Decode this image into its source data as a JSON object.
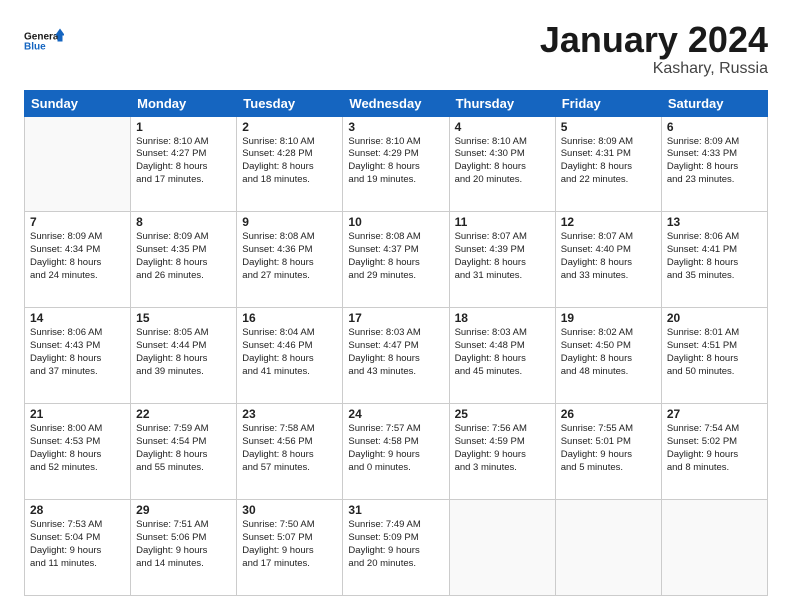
{
  "logo": {
    "line1": "General",
    "line2": "Blue"
  },
  "title": "January 2024",
  "subtitle": "Kashary, Russia",
  "weekdays": [
    "Sunday",
    "Monday",
    "Tuesday",
    "Wednesday",
    "Thursday",
    "Friday",
    "Saturday"
  ],
  "weeks": [
    [
      {
        "day": "",
        "info": ""
      },
      {
        "day": "1",
        "info": "Sunrise: 8:10 AM\nSunset: 4:27 PM\nDaylight: 8 hours\nand 17 minutes."
      },
      {
        "day": "2",
        "info": "Sunrise: 8:10 AM\nSunset: 4:28 PM\nDaylight: 8 hours\nand 18 minutes."
      },
      {
        "day": "3",
        "info": "Sunrise: 8:10 AM\nSunset: 4:29 PM\nDaylight: 8 hours\nand 19 minutes."
      },
      {
        "day": "4",
        "info": "Sunrise: 8:10 AM\nSunset: 4:30 PM\nDaylight: 8 hours\nand 20 minutes."
      },
      {
        "day": "5",
        "info": "Sunrise: 8:09 AM\nSunset: 4:31 PM\nDaylight: 8 hours\nand 22 minutes."
      },
      {
        "day": "6",
        "info": "Sunrise: 8:09 AM\nSunset: 4:33 PM\nDaylight: 8 hours\nand 23 minutes."
      }
    ],
    [
      {
        "day": "7",
        "info": "Sunrise: 8:09 AM\nSunset: 4:34 PM\nDaylight: 8 hours\nand 24 minutes."
      },
      {
        "day": "8",
        "info": "Sunrise: 8:09 AM\nSunset: 4:35 PM\nDaylight: 8 hours\nand 26 minutes."
      },
      {
        "day": "9",
        "info": "Sunrise: 8:08 AM\nSunset: 4:36 PM\nDaylight: 8 hours\nand 27 minutes."
      },
      {
        "day": "10",
        "info": "Sunrise: 8:08 AM\nSunset: 4:37 PM\nDaylight: 8 hours\nand 29 minutes."
      },
      {
        "day": "11",
        "info": "Sunrise: 8:07 AM\nSunset: 4:39 PM\nDaylight: 8 hours\nand 31 minutes."
      },
      {
        "day": "12",
        "info": "Sunrise: 8:07 AM\nSunset: 4:40 PM\nDaylight: 8 hours\nand 33 minutes."
      },
      {
        "day": "13",
        "info": "Sunrise: 8:06 AM\nSunset: 4:41 PM\nDaylight: 8 hours\nand 35 minutes."
      }
    ],
    [
      {
        "day": "14",
        "info": "Sunrise: 8:06 AM\nSunset: 4:43 PM\nDaylight: 8 hours\nand 37 minutes."
      },
      {
        "day": "15",
        "info": "Sunrise: 8:05 AM\nSunset: 4:44 PM\nDaylight: 8 hours\nand 39 minutes."
      },
      {
        "day": "16",
        "info": "Sunrise: 8:04 AM\nSunset: 4:46 PM\nDaylight: 8 hours\nand 41 minutes."
      },
      {
        "day": "17",
        "info": "Sunrise: 8:03 AM\nSunset: 4:47 PM\nDaylight: 8 hours\nand 43 minutes."
      },
      {
        "day": "18",
        "info": "Sunrise: 8:03 AM\nSunset: 4:48 PM\nDaylight: 8 hours\nand 45 minutes."
      },
      {
        "day": "19",
        "info": "Sunrise: 8:02 AM\nSunset: 4:50 PM\nDaylight: 8 hours\nand 48 minutes."
      },
      {
        "day": "20",
        "info": "Sunrise: 8:01 AM\nSunset: 4:51 PM\nDaylight: 8 hours\nand 50 minutes."
      }
    ],
    [
      {
        "day": "21",
        "info": "Sunrise: 8:00 AM\nSunset: 4:53 PM\nDaylight: 8 hours\nand 52 minutes."
      },
      {
        "day": "22",
        "info": "Sunrise: 7:59 AM\nSunset: 4:54 PM\nDaylight: 8 hours\nand 55 minutes."
      },
      {
        "day": "23",
        "info": "Sunrise: 7:58 AM\nSunset: 4:56 PM\nDaylight: 8 hours\nand 57 minutes."
      },
      {
        "day": "24",
        "info": "Sunrise: 7:57 AM\nSunset: 4:58 PM\nDaylight: 9 hours\nand 0 minutes."
      },
      {
        "day": "25",
        "info": "Sunrise: 7:56 AM\nSunset: 4:59 PM\nDaylight: 9 hours\nand 3 minutes."
      },
      {
        "day": "26",
        "info": "Sunrise: 7:55 AM\nSunset: 5:01 PM\nDaylight: 9 hours\nand 5 minutes."
      },
      {
        "day": "27",
        "info": "Sunrise: 7:54 AM\nSunset: 5:02 PM\nDaylight: 9 hours\nand 8 minutes."
      }
    ],
    [
      {
        "day": "28",
        "info": "Sunrise: 7:53 AM\nSunset: 5:04 PM\nDaylight: 9 hours\nand 11 minutes."
      },
      {
        "day": "29",
        "info": "Sunrise: 7:51 AM\nSunset: 5:06 PM\nDaylight: 9 hours\nand 14 minutes."
      },
      {
        "day": "30",
        "info": "Sunrise: 7:50 AM\nSunset: 5:07 PM\nDaylight: 9 hours\nand 17 minutes."
      },
      {
        "day": "31",
        "info": "Sunrise: 7:49 AM\nSunset: 5:09 PM\nDaylight: 9 hours\nand 20 minutes."
      },
      {
        "day": "",
        "info": ""
      },
      {
        "day": "",
        "info": ""
      },
      {
        "day": "",
        "info": ""
      }
    ]
  ]
}
